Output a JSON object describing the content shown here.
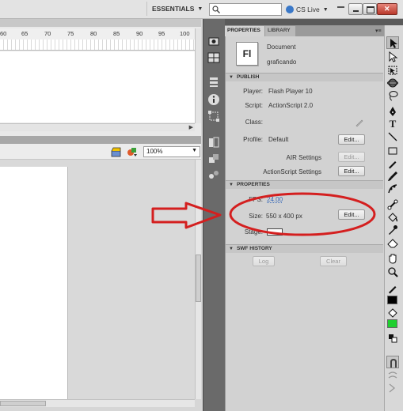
{
  "topbar": {
    "workspace_label": "ESSENTIALS",
    "search_placeholder": "",
    "cs_live_label": "CS Live"
  },
  "timeline": {
    "ruler_ticks": [
      "60",
      "65",
      "70",
      "75",
      "80",
      "85",
      "90",
      "95",
      "100"
    ]
  },
  "stage": {
    "zoom_value": "100%"
  },
  "panel": {
    "tabs": [
      {
        "label": "PROPERTIES",
        "active": true
      },
      {
        "label": "LIBRARY",
        "active": false
      }
    ],
    "document": {
      "icon_text": "Fl",
      "type": "Document",
      "name": "graficando"
    },
    "publish": {
      "header": "PUBLISH",
      "player_label": "Player:",
      "player_value": "Flash Player 10",
      "script_label": "Script:",
      "script_value": "ActionScript 2.0",
      "class_label": "Class:",
      "profile_label": "Profile:",
      "profile_value": "Default",
      "profile_edit": "Edit...",
      "air_settings_label": "AIR Settings",
      "air_edit": "Edit...",
      "as_settings_label": "ActionScript Settings",
      "as_edit": "Edit..."
    },
    "properties": {
      "header": "PROPERTIES",
      "fps_label": "FPS:",
      "fps_value": "24.00",
      "size_label": "Size:",
      "size_value": "550 x 400 px",
      "size_edit": "Edit...",
      "stage_label": "Stage:",
      "stage_color": "#ffffff"
    },
    "swf_history": {
      "header": "SWF HISTORY",
      "log_label": "Log",
      "clear_label": "Clear"
    }
  },
  "colors": {
    "annotation_red": "#d41f1f",
    "stroke_color": "#000000",
    "fill_color": "#1fcf2f"
  },
  "icons": {
    "strip": [
      "motion-presets-icon",
      "align-icon",
      "color-icon",
      "info-icon",
      "transform-icon",
      "library-icon",
      "components-icon",
      "behaviors-icon"
    ],
    "tools": [
      "selection-tool-icon",
      "subselection-tool-icon",
      "free-transform-icon",
      "3d-rotation-icon",
      "lasso-icon",
      "pen-icon",
      "text-tool-icon",
      "line-tool-icon",
      "rectangle-tool-icon",
      "pencil-tool-icon",
      "brush-tool-icon",
      "deco-tool-icon",
      "bone-tool-icon",
      "paint-bucket-icon",
      "eyedropper-icon",
      "eraser-icon",
      "hand-tool-icon",
      "zoom-tool-icon",
      "stroke-color-icon",
      "fill-color-icon",
      "swap-colors-icon",
      "snap-magnet-icon",
      "smooth-icon",
      "straighten-icon"
    ]
  }
}
